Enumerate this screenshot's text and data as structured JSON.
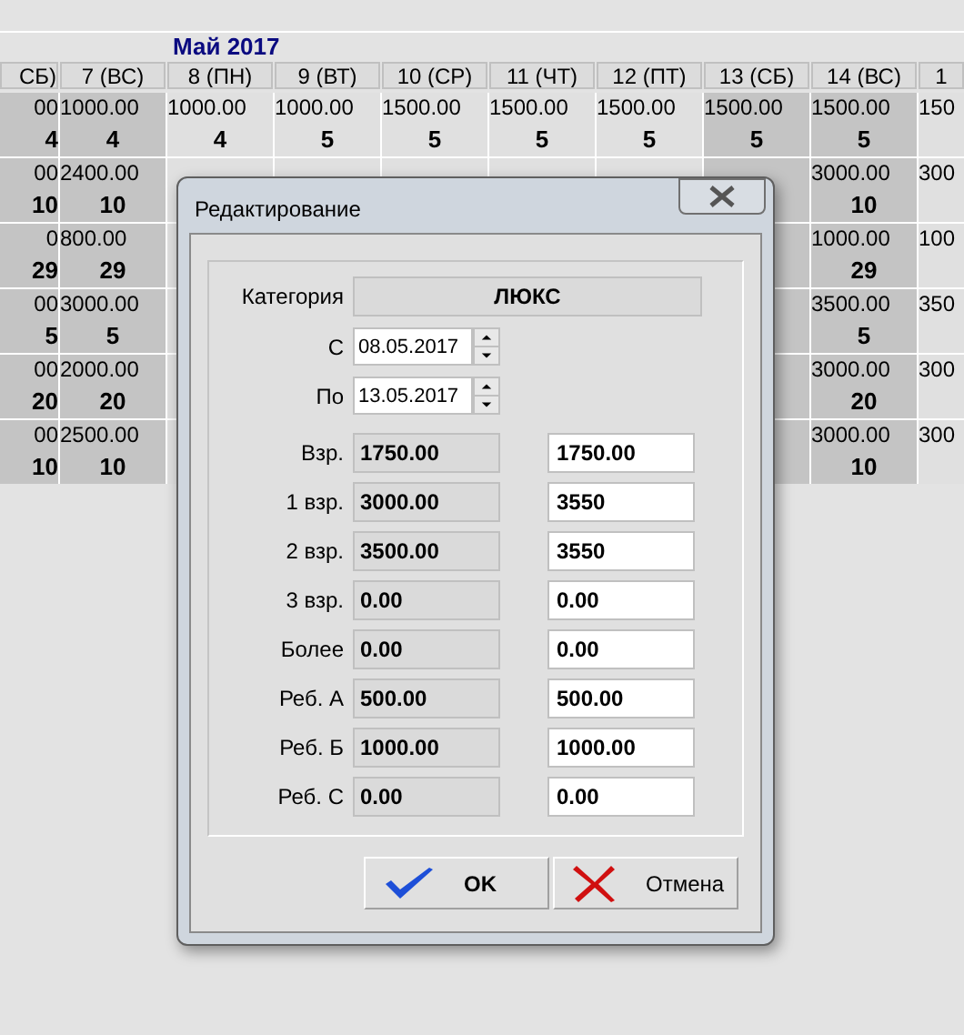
{
  "header": {
    "title": "Май 2017"
  },
  "grid": {
    "columns": [
      {
        "label": "СБ)",
        "weekend": true
      },
      {
        "label": "7 (ВС)",
        "weekend": true
      },
      {
        "label": "8 (ПН)",
        "weekend": false
      },
      {
        "label": "9 (ВТ)",
        "weekend": false
      },
      {
        "label": "10 (СР)",
        "weekend": false
      },
      {
        "label": "11 (ЧТ)",
        "weekend": false
      },
      {
        "label": "12 (ПТ)",
        "weekend": false
      },
      {
        "label": "13 (СБ)",
        "weekend": true
      },
      {
        "label": "14 (ВС)",
        "weekend": true
      },
      {
        "label": "1",
        "weekend": false
      }
    ],
    "rows": [
      [
        {
          "price": "00",
          "count": "4"
        },
        {
          "price": "1000.00",
          "count": "4"
        },
        {
          "price": "1000.00",
          "count": "4"
        },
        {
          "price": "1000.00",
          "count": "5"
        },
        {
          "price": "1500.00",
          "count": "5"
        },
        {
          "price": "1500.00",
          "count": "5"
        },
        {
          "price": "1500.00",
          "count": "5"
        },
        {
          "price": "1500.00",
          "count": "5"
        },
        {
          "price": "1500.00",
          "count": "5"
        },
        {
          "price": "150"
        }
      ],
      [
        {
          "price": "00",
          "count": "10"
        },
        {
          "price": "2400.00",
          "count": "10"
        },
        {},
        {},
        {},
        {},
        {},
        {},
        {
          "price": "3000.00",
          "count": "10"
        },
        {
          "price": "300"
        }
      ],
      [
        {
          "price": "0",
          "count": "29"
        },
        {
          "price": "800.00",
          "count": "29"
        },
        {},
        {},
        {},
        {},
        {},
        {},
        {
          "price": "1000.00",
          "count": "29"
        },
        {
          "price": "100"
        }
      ],
      [
        {
          "price": "00",
          "count": "5"
        },
        {
          "price": "3000.00",
          "count": "5"
        },
        {},
        {},
        {},
        {},
        {},
        {},
        {
          "price": "3500.00",
          "count": "5"
        },
        {
          "price": "350"
        }
      ],
      [
        {
          "price": "00",
          "count": "20"
        },
        {
          "price": "2000.00",
          "count": "20"
        },
        {},
        {},
        {},
        {},
        {},
        {},
        {
          "price": "3000.00",
          "count": "20"
        },
        {
          "price": "300"
        }
      ],
      [
        {
          "price": "00",
          "count": "10"
        },
        {
          "price": "2500.00",
          "count": "10"
        },
        {},
        {},
        {},
        {},
        {},
        {},
        {
          "price": "3000.00",
          "count": "10"
        },
        {
          "price": "300"
        }
      ]
    ]
  },
  "dialog": {
    "title": "Редактирование",
    "category": {
      "label": "Категория",
      "value": "ЛЮКС"
    },
    "dates": [
      {
        "label": "С",
        "value": "08.05.2017"
      },
      {
        "label": "По",
        "value": "13.05.2017"
      }
    ],
    "prices": [
      {
        "label": "Взр.",
        "current": "1750.00",
        "value": "1750.00"
      },
      {
        "label": "1 взр.",
        "current": "3000.00",
        "value": "3550"
      },
      {
        "label": "2 взр.",
        "current": "3500.00",
        "value": "3550"
      },
      {
        "label": "3 взр.",
        "current": "0.00",
        "value": "0.00"
      },
      {
        "label": "Более",
        "current": "0.00",
        "value": "0.00"
      },
      {
        "label": "Реб. А",
        "current": "500.00",
        "value": "500.00"
      },
      {
        "label": "Реб. Б",
        "current": "1000.00",
        "value": "1000.00"
      },
      {
        "label": "Реб. С",
        "current": "0.00",
        "value": "0.00"
      }
    ],
    "buttons": [
      {
        "label": "OK",
        "kind": "ok"
      },
      {
        "label": "Отмена",
        "kind": "cancel"
      }
    ]
  }
}
